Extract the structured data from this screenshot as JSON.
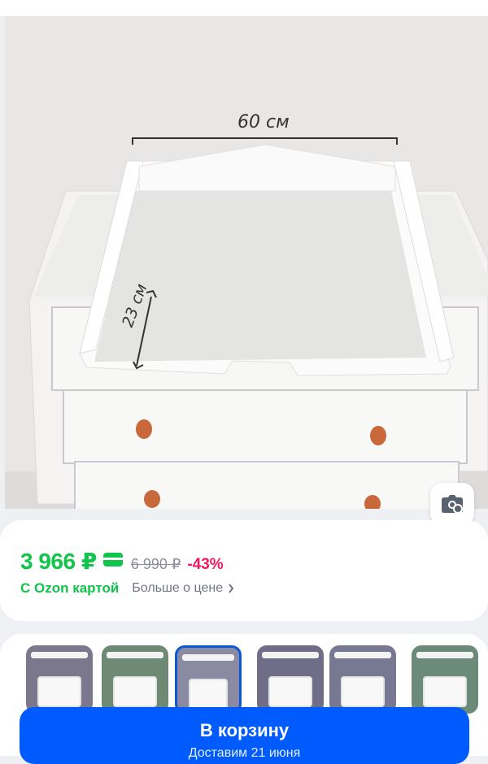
{
  "product_image": {
    "dimension_width": "60 см",
    "dimension_height": "23 см"
  },
  "price": {
    "current": "3 966 ₽",
    "old": "6 990 ₽",
    "discount": "-43%",
    "ozon_card_label": "С Ozon картой",
    "more_about_price": "Больше о цене"
  },
  "thumbnails": [
    {
      "bg": "#7b778d",
      "selected": false
    },
    {
      "bg": "#6e8a74",
      "selected": false
    },
    {
      "bg": "#8a8aa2",
      "selected": true
    },
    {
      "bg": "#6f6d88",
      "selected": false
    },
    {
      "bg": "#777891",
      "selected": false
    },
    {
      "bg": "#6c8a79",
      "selected": false
    }
  ],
  "cart_button": {
    "label": "В корзину",
    "delivery": "Доставим 21 июня"
  },
  "colors": {
    "price_green": "#10c44c",
    "discount_pink": "#f2185c",
    "cta_blue": "#005bff"
  }
}
